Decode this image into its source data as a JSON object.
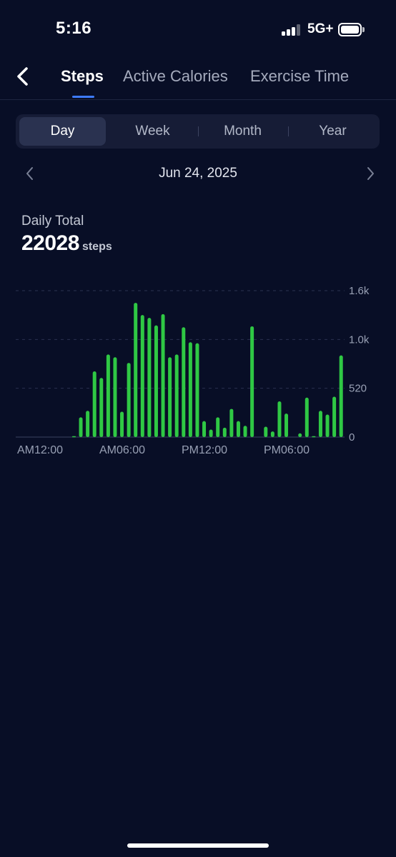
{
  "status_bar": {
    "time": "5:16",
    "network": "5G+",
    "signal_bars_active": 3,
    "signal_bars_total": 4,
    "battery_level": 0.9
  },
  "header": {
    "back_icon": "chevron-left-icon",
    "tabs": [
      {
        "label": "Steps",
        "active": true
      },
      {
        "label": "Active Calories",
        "active": false
      },
      {
        "label": "Exercise Time",
        "active": false
      }
    ],
    "accent_color": "#3d7bff"
  },
  "period_selector": {
    "options": [
      "Day",
      "Week",
      "Month",
      "Year"
    ],
    "selected": "Day"
  },
  "date_nav": {
    "date": "Jun 24, 2025",
    "prev_icon": "chevron-left-icon",
    "next_icon": "chevron-right-icon"
  },
  "summary": {
    "label": "Daily Total",
    "value": "22028",
    "unit": "steps"
  },
  "chart_data": {
    "type": "bar",
    "bar_color": "#2fc844",
    "x_tick_labels": [
      "AM12:00",
      "AM06:00",
      "PM12:00",
      "PM06:00"
    ],
    "y_tick_labels": [
      "1.6k",
      "1.0k",
      "520",
      "0"
    ],
    "y_ticks": [
      1560,
      1040,
      520,
      0
    ],
    "ylim": [
      0,
      1560
    ],
    "grid": "dashed horizontal",
    "bucket_minutes": 30,
    "values": [
      0,
      0,
      0,
      0,
      0,
      0,
      0,
      0,
      10,
      210,
      280,
      700,
      630,
      880,
      850,
      270,
      790,
      1430,
      1300,
      1270,
      1190,
      1310,
      850,
      880,
      1170,
      1010,
      1000,
      170,
      80,
      210,
      100,
      300,
      170,
      120,
      1180,
      0,
      110,
      60,
      380,
      250,
      0,
      40,
      420,
      10,
      280,
      240,
      430,
      870
    ]
  }
}
